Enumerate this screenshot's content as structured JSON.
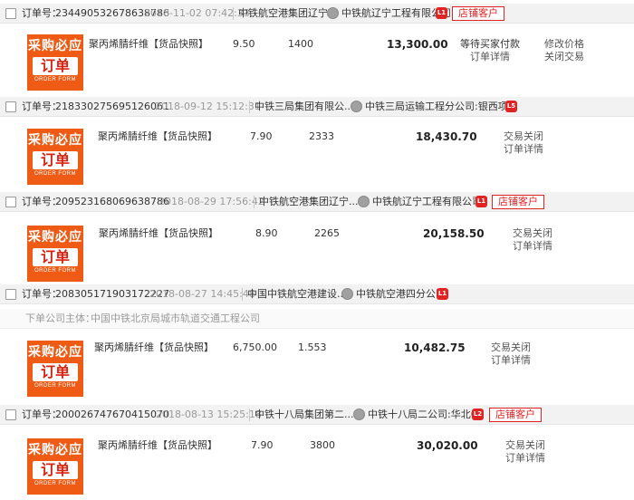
{
  "orders": [
    {
      "order_label": "订单号：",
      "order_no": "234490532678638786",
      "datetime": "2018-11-02 07:42:33",
      "buyer": "中铁航空港集团辽宁...",
      "seller": "中铁航辽宁工程有限公司",
      "level_icon": "L1",
      "badge": "店铺客户",
      "logo": {
        "top": "采购必应",
        "mid": "订单",
        "en": "ORDER FORM"
      },
      "product": "聚丙烯腈纤维",
      "snapshot": "【货品快照】",
      "price": "9.50",
      "qty": "1400",
      "total": "13,300.00",
      "status_lines": [
        "等待买家付款",
        "订单详情"
      ],
      "actions": [
        "修改价格",
        "关闭交易"
      ]
    },
    {
      "order_label": "订单号：",
      "order_no": "218330275695126061",
      "datetime": "2018-09-12 15:12:31",
      "buyer": "中铁三局集团有限公...",
      "seller": "中铁三局运输工程分公司:银西项目",
      "level_icon": "L5",
      "logo": {
        "top": "采购必应",
        "mid": "订单",
        "en": "ORDER FORM"
      },
      "product": "聚丙烯腈纤维",
      "snapshot": "【货品快照】",
      "price": "7.90",
      "qty": "2333",
      "total": "18,430.70",
      "status_lines": [
        "交易关闭",
        "订单详情"
      ]
    },
    {
      "order_label": "订单号：",
      "order_no": "209523168069638786",
      "datetime": "2018-08-29 17:56:42",
      "buyer": "中铁航空港集团辽宁...",
      "seller": "中铁航辽宁工程有限公司",
      "level_icon": "L1",
      "badge": "店铺客户",
      "logo": {
        "top": "采购必应",
        "mid": "订单",
        "en": "ORDER FORM"
      },
      "product": "聚丙烯腈纤维",
      "snapshot": "【货品快照】",
      "price": "8.90",
      "qty": "2265",
      "total": "20,158.50",
      "status_lines": [
        "交易关闭",
        "订单详情"
      ]
    },
    {
      "order_label": "订单号：",
      "order_no": "208305171903172227",
      "datetime": "2018-08-27 14:45:48",
      "buyer": "中国中铁航空港建设...",
      "seller": "中铁航空港四分公司",
      "level_icon": "L1",
      "sub_label": "下单公司主体：",
      "sub_value": "中国中铁北京局城市轨道交通工程公司",
      "logo": {
        "top": "采购必应",
        "mid": "订单",
        "en": "ORDER FORM"
      },
      "product": "聚丙烯腈纤维",
      "snapshot": "【货品快照】",
      "price": "6,750.00",
      "qty": "1.553",
      "total": "10,482.75",
      "status_lines": [
        "交易关闭",
        "订单详情"
      ]
    },
    {
      "order_label": "订单号：",
      "order_no": "200026747670415070",
      "datetime": "2018-08-13 15:25:18",
      "buyer": "中铁十八局集团第二...",
      "seller": "中铁十八局二公司:华北01",
      "level_icon": "L2",
      "badge": "店铺客户",
      "logo": {
        "top": "采购必应",
        "mid": "订单",
        "en": "ORDER FORM"
      },
      "product": "聚丙烯腈纤维",
      "snapshot": "【货品快照】",
      "price": "7.90",
      "qty": "3800",
      "total": "30,020.00",
      "status_lines": [
        "交易关闭",
        "订单详情"
      ]
    }
  ],
  "colors": {
    "accent_red": "#e02323",
    "logo_orange": "#ef5a14",
    "header_bg": "#f2f2f2"
  },
  "icons": {
    "avatar": "buyer-avatar-icon",
    "level": "member-level-icon",
    "checkbox": "select-checkbox"
  }
}
